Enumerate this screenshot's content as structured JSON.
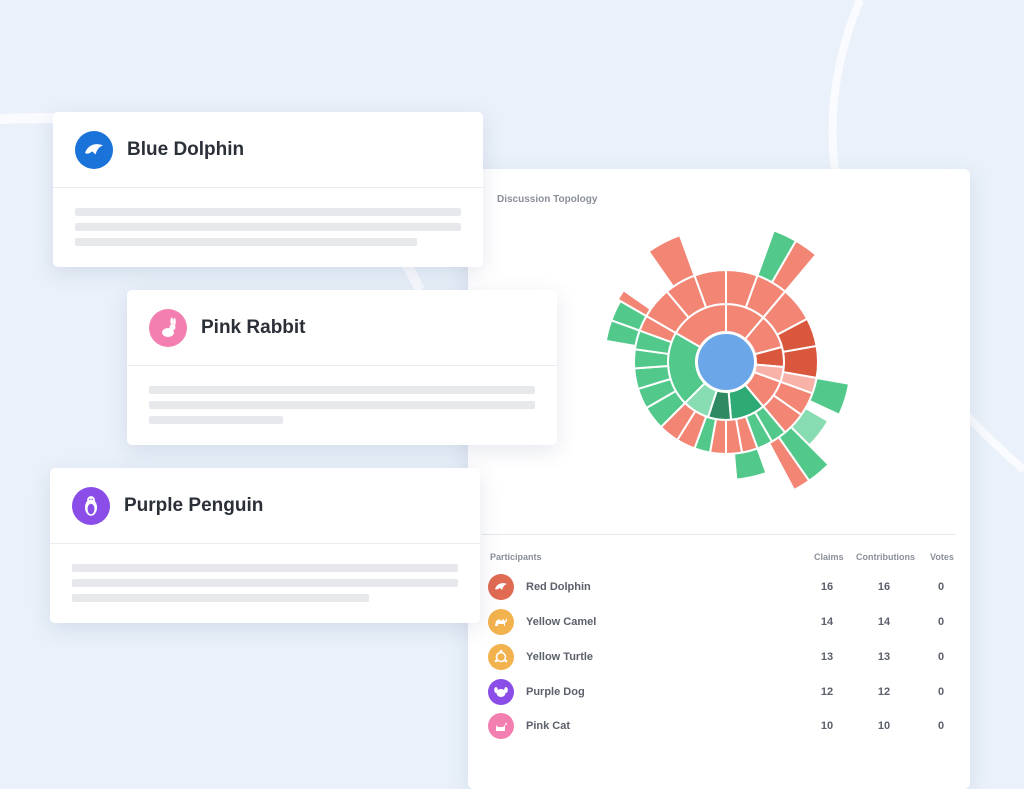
{
  "cards": [
    {
      "name": "Blue Dolphin",
      "icon": "dolphin-icon",
      "color": "#1a73d9"
    },
    {
      "name": "Pink Rabbit",
      "icon": "rabbit-icon",
      "color": "#f37fb0"
    },
    {
      "name": "Purple Penguin",
      "icon": "penguin-icon",
      "color": "#8a4de8"
    }
  ],
  "panel": {
    "title": "Discussion Topology",
    "table": {
      "headers": {
        "participants": "Participants",
        "claims": "Claims",
        "contributions": "Contributions",
        "votes": "Votes"
      },
      "rows": [
        {
          "name": "Red Dolphin",
          "claims": "16",
          "contributions": "16",
          "votes": "0",
          "icon": "dolphin-icon",
          "color": "#e06a52"
        },
        {
          "name": "Yellow Camel",
          "claims": "14",
          "contributions": "14",
          "votes": "0",
          "icon": "camel-icon",
          "color": "#f2b24d"
        },
        {
          "name": "Yellow Turtle",
          "claims": "13",
          "contributions": "13",
          "votes": "0",
          "icon": "turtle-icon",
          "color": "#f2b24d"
        },
        {
          "name": "Purple Dog",
          "claims": "12",
          "contributions": "12",
          "votes": "0",
          "icon": "dog-icon",
          "color": "#8a4de8"
        },
        {
          "name": "Pink Cat",
          "claims": "10",
          "contributions": "10",
          "votes": "0",
          "icon": "cat-icon",
          "color": "#f37fb0"
        }
      ]
    }
  },
  "colors": {
    "red": "#f28574",
    "dark_red": "#d9573c",
    "pink": "#f9b2a8",
    "green": "#52c98b",
    "dark_green": "#2eaa74",
    "deep_green": "#2f8a63",
    "light_green": "#88dcb2",
    "center": "#6aa6e8"
  }
}
